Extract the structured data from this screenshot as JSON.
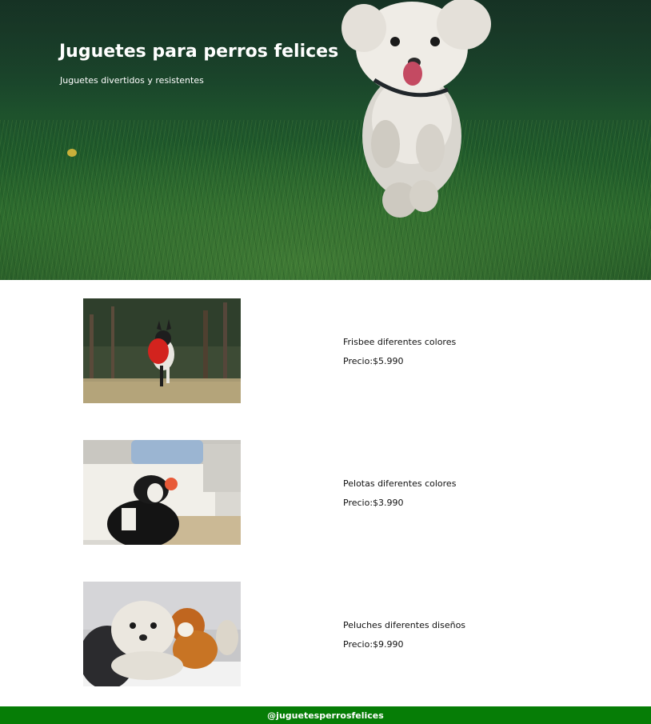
{
  "hero": {
    "title": "Juguetes para perros felices",
    "subtitle": "Juguetes divertidos y resistentes",
    "image": "running-white-dog-on-grass"
  },
  "products": [
    {
      "name": "Frisbee diferentes colores",
      "price_label": "Precio:",
      "price": "$5.990",
      "image": "dog-with-red-frisbee"
    },
    {
      "name": "Pelotas diferentes colores",
      "price_label": "Precio:",
      "price": "$3.990",
      "image": "dog-with-ball-on-couch"
    },
    {
      "name": "Peluches diferentes diseños",
      "price_label": "Precio:",
      "price": "$9.990",
      "image": "dog-with-plush-toy"
    }
  ],
  "footer": {
    "handle": "@juguetesperrosfelices"
  },
  "colors": {
    "footer_bg": "#067d06",
    "hero_grass": "#1f5a2b",
    "text": "#111111"
  }
}
